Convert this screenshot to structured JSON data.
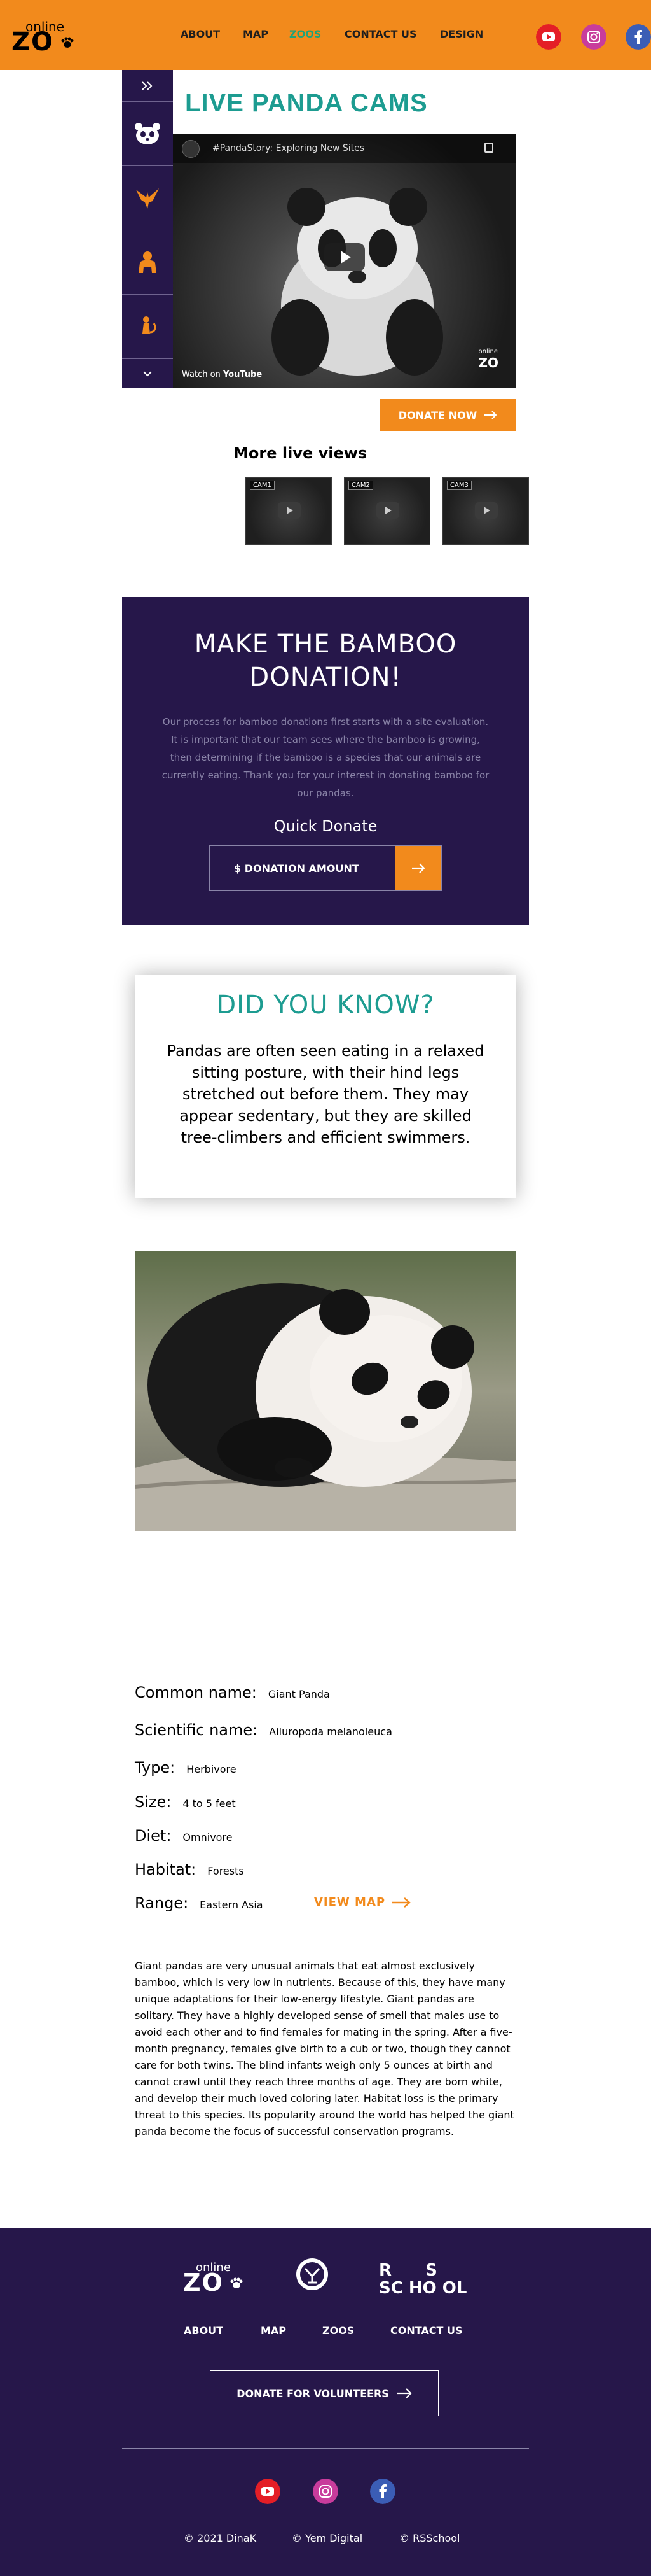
{
  "header": {
    "logo_top": "online",
    "logo_bottom": "ZO",
    "nav": [
      "ABOUT",
      "MAP",
      "ZOOS",
      "CONTACT US",
      "DESIGN"
    ],
    "active_nav": "ZOOS",
    "socials": [
      "youtube-icon",
      "instagram-icon",
      "facebook-icon"
    ]
  },
  "sidebar": {
    "items": [
      "expand-icon",
      "panda-icon",
      "eagle-icon",
      "gorilla-icon",
      "lemur-icon",
      "chevron-down-icon"
    ]
  },
  "live": {
    "title": "LIVE PANDA CAMS",
    "video_title": "#PandaStory: Exploring New Sites",
    "watch_on": "Watch on",
    "youtube": "YouTube",
    "video_logo_top": "online",
    "video_logo_bottom": "ZO",
    "donate_button": "DONATE NOW",
    "more_title": "More live views",
    "thumbs": [
      "CAM1",
      "CAM2",
      "CAM3"
    ]
  },
  "bamboo": {
    "title_line1": "MAKE THE BAMBOO",
    "title_line2": "DONATION!",
    "text": "Our process for bamboo donations first starts with a site evaluation. It is important that our team sees where the bamboo is growing, then determining if the bamboo is a species that our animals are currently eating. Thank you for your interest in donating bamboo for our pandas.",
    "quick_donate": "Quick Donate",
    "amount_label": "$ DONATION AMOUNT"
  },
  "did_you_know": {
    "title": "DID YOU KNOW?",
    "text": "Pandas are often seen eating in a relaxed sitting posture, with their hind legs stretched out before them. They may appear sedentary, but they are skilled tree-climbers and efficient swimmers."
  },
  "info": {
    "common_name_label": "Common name:",
    "common_name": "Giant Panda",
    "scientific_name_label": "Scientific name:",
    "scientific_name": "Ailuropoda melanoleuca",
    "type_label": "Type:",
    "type": "Herbivore",
    "size_label": "Size:",
    "size": "4 to 5 feet",
    "diet_label": "Diet:",
    "diet": "Omnivore",
    "habitat_label": "Habitat:",
    "habitat": "Forests",
    "range_label": "Range:",
    "range": "Eastern Asia",
    "view_map": "VIEW MAP",
    "description": "Giant pandas are very unusual animals that eat almost exclusively bamboo, which is very low in nutrients. Because of this, they have many unique adaptations for their low-energy lifestyle. Giant pandas are solitary. They have a highly developed sense of smell that males use to avoid each other and to find females for mating in the spring. After a five-month pregnancy, females give birth to a cub or two, though they cannot care for both twins. The blind infants weigh only 5 ounces at birth and cannot crawl until they reach three months of age. They are born white, and develop their much loved coloring later. Habitat loss is the primary threat to this species. Its popularity around the world has helped the giant panda become the focus of successful conservation programs."
  },
  "footer": {
    "logo_top": "online",
    "logo_bottom": "ZO",
    "school_top": "R S",
    "school_bottom": "SC HO OL",
    "nav": [
      "ABOUT",
      "MAP",
      "ZOOS",
      "CONTACT US"
    ],
    "donate_button": "DONATE FOR VOLUNTEERS",
    "copyright": [
      "© 2021 DinaK",
      "© Yem Digital",
      "© RSSchool"
    ]
  },
  "colors": {
    "orange": "#f28a1c",
    "purple": "#26174a",
    "teal": "#1d9c91",
    "green_active": "#1fa37a"
  }
}
